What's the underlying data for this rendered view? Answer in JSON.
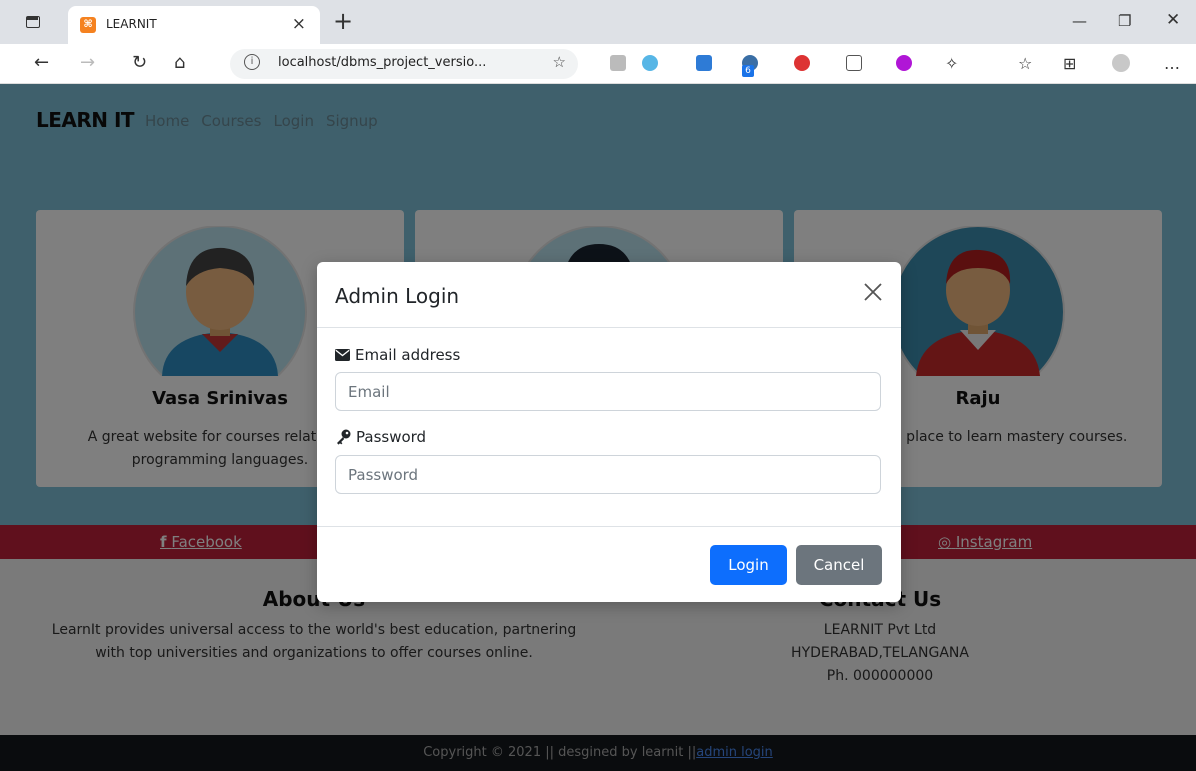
{
  "browser": {
    "tab_title": "LEARNIT",
    "url": "localhost/dbms_project_versio...",
    "extension_badge": "6"
  },
  "site": {
    "brand": "LEARN IT",
    "nav": [
      "Home",
      "Courses",
      "Login",
      "Signup"
    ]
  },
  "cards": [
    {
      "name": "Vasa Srinivas",
      "text": "A great website for courses related to programming languages."
    },
    {
      "name": "",
      "text": ""
    },
    {
      "name": "Raju",
      "text": "Best place place to learn mastery courses."
    }
  ],
  "social": {
    "facebook": "Facebook",
    "instagram": "Instagram"
  },
  "about": {
    "heading": "About Us",
    "text": "LearnIt provides universal access to the world's best education, partnering with top universities and organizations to offer courses online."
  },
  "contact": {
    "heading": "Contact Us",
    "company": "LEARNIT Pvt Ltd",
    "city": "HYDERABAD,TELANGANA",
    "phone": "Ph. 000000000"
  },
  "copyright": {
    "text": "Copyright © 2021 || desgined by learnit ||",
    "admin_link": "admin login"
  },
  "modal": {
    "title": "Admin Login",
    "email_label": "Email address",
    "email_placeholder": "Email",
    "email_value": "",
    "password_label": "Password",
    "password_placeholder": "Password",
    "password_value": "",
    "login_button": "Login",
    "cancel_button": "Cancel"
  },
  "colors": {
    "hero_bg": "#7ec0d8",
    "social_bar": "#c0203a",
    "primary": "#0d6efd",
    "secondary": "#6c757d",
    "footer_dark": "#15191d"
  }
}
